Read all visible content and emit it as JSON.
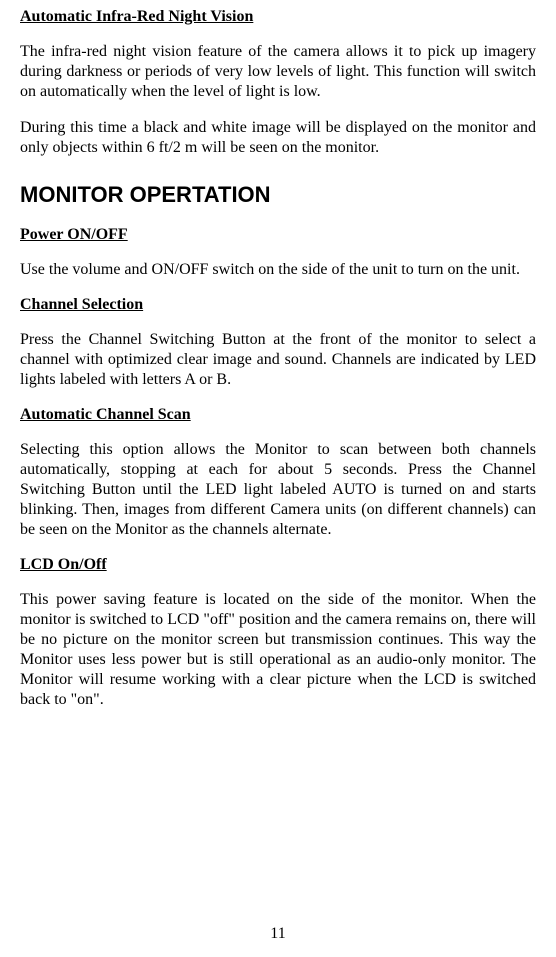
{
  "sections": {
    "nightVision": {
      "heading": "Automatic Infra-Red Night Vision",
      "p1": "The infra-red night vision feature of the camera allows it to pick up imagery during darkness or periods of very low levels of light. This function will switch on automatically when the level of light is low.",
      "p2": "During this time a black and white image will be displayed on the monitor and only objects within 6 ft/2 m will be seen on the monitor."
    },
    "monitorOperation": {
      "heading": "MONITOR OPERTATION"
    },
    "powerOnOff": {
      "heading": "Power ON/OFF",
      "p1": "Use the volume and ON/OFF switch on the side of the unit to turn on the unit."
    },
    "channelSelection": {
      "heading": "Channel Selection",
      "p1": "Press the Channel Switching Button at the front of the monitor to select a channel with optimized clear image and sound. Channels are indicated by LED lights labeled with letters A or B."
    },
    "autoChannelScan": {
      "heading": "Automatic Channel Scan",
      "p1": "Selecting this option allows the Monitor to scan between both channels automatically, stopping at each for about 5 seconds. Press the Channel Switching Button until the LED light labeled AUTO is turned on and starts blinking. Then, images from different Camera units (on different channels) can be seen on the Monitor as the channels alternate."
    },
    "lcdOnOff": {
      "heading": "LCD On/Off",
      "p1": "This power saving feature is located on the side of the monitor. When the monitor is switched to LCD \"off\" position and the camera remains on, there will be no picture on the monitor screen but transmission continues. This way the Monitor uses less power but is still operational as an audio-only monitor. The Monitor will resume working with a clear picture when the LCD is switched back to \"on\"."
    }
  },
  "pageNumber": "11"
}
